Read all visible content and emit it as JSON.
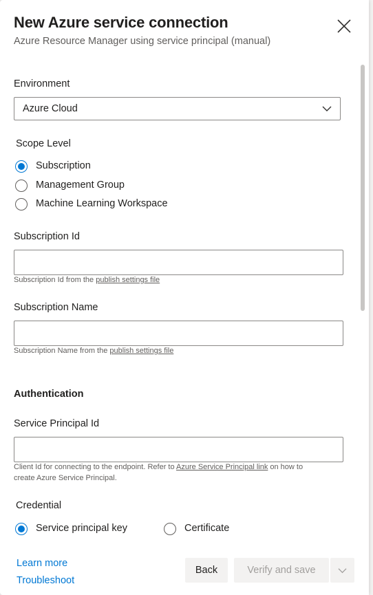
{
  "header": {
    "title": "New Azure service connection",
    "subtitle": "Azure Resource Manager using service principal (manual)"
  },
  "icons": {
    "close": "close-icon",
    "dropdown": "chevron-down-icon",
    "split": "chevron-down-icon"
  },
  "environment": {
    "label": "Environment",
    "selected": "Azure Cloud"
  },
  "scope": {
    "label": "Scope Level",
    "options": [
      "Subscription",
      "Management Group",
      "Machine Learning Workspace"
    ],
    "selected": "Subscription"
  },
  "subscription_id": {
    "label": "Subscription Id",
    "value": "",
    "helper_prefix": "Subscription Id from the ",
    "helper_link": "publish settings file"
  },
  "subscription_name": {
    "label": "Subscription Name",
    "value": "",
    "helper_prefix": "Subscription Name from the ",
    "helper_link": "publish settings file"
  },
  "authentication": {
    "heading": "Authentication",
    "sp_id_label": "Service Principal Id",
    "sp_id_value": "",
    "sp_helper_prefix": "Client Id for connecting to the endpoint. Refer to ",
    "sp_helper_link": "Azure Service Principal link",
    "sp_helper_suffix": " on how to",
    "sp_helper_line2": "create Azure Service Principal."
  },
  "credential": {
    "label": "Credential",
    "options": [
      "Service principal key",
      "Certificate"
    ],
    "selected": "Service principal key"
  },
  "footer": {
    "learn_more": "Learn more",
    "troubleshoot": "Troubleshoot",
    "back": "Back",
    "verify_save": "Verify and save"
  },
  "colors": {
    "accent": "#0078d4",
    "disabled_text": "#a19f9d",
    "button_bg": "#f3f2f1"
  }
}
